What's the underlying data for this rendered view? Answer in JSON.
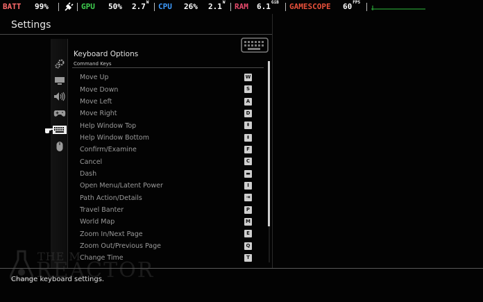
{
  "overlay": {
    "batt_label": "BATT",
    "batt_value": "99%",
    "gpu_label": "GPU",
    "gpu_util": "50%",
    "gpu_power": "2.7",
    "gpu_power_unit": "W",
    "cpu_label": "CPU",
    "cpu_util": "26%",
    "cpu_power": "2.1",
    "cpu_power_unit": "W",
    "ram_label": "RAM",
    "ram_value": "6.1",
    "ram_unit": "GiB",
    "app_label": "GAMESCOPE",
    "fps_value": "60",
    "fps_unit": "FPS",
    "colors": {
      "batt": "#ff6b6b",
      "gpu": "#3fcf4f",
      "cpu": "#3d9bff",
      "ram": "#e84a6c",
      "app": "#e8503a",
      "value": "#ffffff",
      "graph": "#2fbf3f"
    }
  },
  "header": {
    "title": "Settings"
  },
  "sidebar": {
    "categories": [
      {
        "icon": "gears-icon",
        "label": "Gameplay"
      },
      {
        "icon": "monitor-icon",
        "label": "Graphics"
      },
      {
        "icon": "speaker-icon",
        "label": "Audio"
      },
      {
        "icon": "gamepad-icon",
        "label": "Controller"
      },
      {
        "icon": "keyboard-icon",
        "label": "Keyboard",
        "selected": true
      },
      {
        "icon": "mouse-icon",
        "label": "Mouse"
      }
    ]
  },
  "panel": {
    "title": "Keyboard Options",
    "subtitle": "Command Keys",
    "bindings": [
      {
        "action": "Move Up",
        "key": "W"
      },
      {
        "action": "Move Down",
        "key": "S"
      },
      {
        "action": "Move Left",
        "key": "A"
      },
      {
        "action": "Move Right",
        "key": "D"
      },
      {
        "action": "Help Window Top",
        "key": "⇞"
      },
      {
        "action": "Help Window Bottom",
        "key": "⇟"
      },
      {
        "action": "Confirm/Examine",
        "key": "F"
      },
      {
        "action": "Cancel",
        "key": "C"
      },
      {
        "action": "Dash",
        "key": "▬"
      },
      {
        "action": "Open Menu/Latent Power",
        "key": "I"
      },
      {
        "action": "Path Action/Details",
        "key": "⇥"
      },
      {
        "action": "Travel Banter",
        "key": "P"
      },
      {
        "action": "World Map",
        "key": "M"
      },
      {
        "action": "Zoom In/Next Page",
        "key": "E"
      },
      {
        "action": "Zoom Out/Previous Page",
        "key": "Q"
      },
      {
        "action": "Change Time",
        "key": "T"
      }
    ],
    "scroll_fraction_visible": 0.82
  },
  "watermark": {
    "top": "THE M",
    "main": "REACTOR"
  },
  "footer": {
    "help_text": "Change keyboard settings."
  }
}
